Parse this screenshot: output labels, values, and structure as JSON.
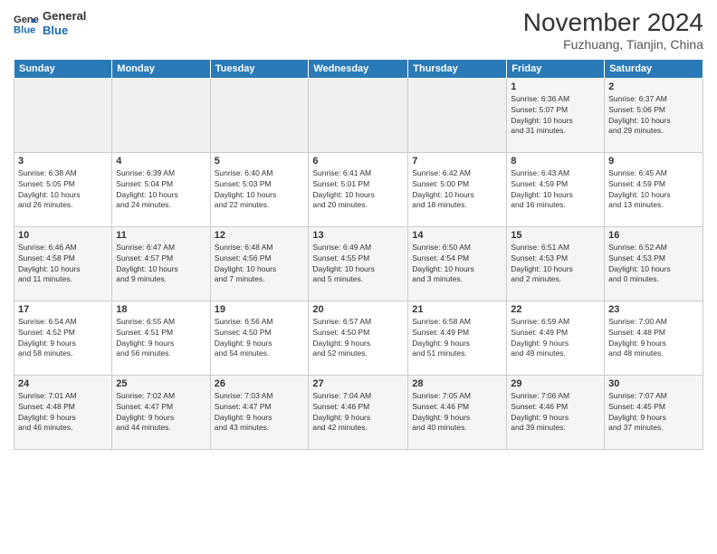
{
  "logo": {
    "line1": "General",
    "line2": "Blue"
  },
  "title": "November 2024",
  "subtitle": "Fuzhuang, Tianjin, China",
  "weekdays": [
    "Sunday",
    "Monday",
    "Tuesday",
    "Wednesday",
    "Thursday",
    "Friday",
    "Saturday"
  ],
  "weeks": [
    [
      {
        "day": "",
        "info": ""
      },
      {
        "day": "",
        "info": ""
      },
      {
        "day": "",
        "info": ""
      },
      {
        "day": "",
        "info": ""
      },
      {
        "day": "",
        "info": ""
      },
      {
        "day": "1",
        "info": "Sunrise: 6:36 AM\nSunset: 5:07 PM\nDaylight: 10 hours\nand 31 minutes."
      },
      {
        "day": "2",
        "info": "Sunrise: 6:37 AM\nSunset: 5:06 PM\nDaylight: 10 hours\nand 29 minutes."
      }
    ],
    [
      {
        "day": "3",
        "info": "Sunrise: 6:38 AM\nSunset: 5:05 PM\nDaylight: 10 hours\nand 26 minutes."
      },
      {
        "day": "4",
        "info": "Sunrise: 6:39 AM\nSunset: 5:04 PM\nDaylight: 10 hours\nand 24 minutes."
      },
      {
        "day": "5",
        "info": "Sunrise: 6:40 AM\nSunset: 5:03 PM\nDaylight: 10 hours\nand 22 minutes."
      },
      {
        "day": "6",
        "info": "Sunrise: 6:41 AM\nSunset: 5:01 PM\nDaylight: 10 hours\nand 20 minutes."
      },
      {
        "day": "7",
        "info": "Sunrise: 6:42 AM\nSunset: 5:00 PM\nDaylight: 10 hours\nand 18 minutes."
      },
      {
        "day": "8",
        "info": "Sunrise: 6:43 AM\nSunset: 4:59 PM\nDaylight: 10 hours\nand 16 minutes."
      },
      {
        "day": "9",
        "info": "Sunrise: 6:45 AM\nSunset: 4:59 PM\nDaylight: 10 hours\nand 13 minutes."
      }
    ],
    [
      {
        "day": "10",
        "info": "Sunrise: 6:46 AM\nSunset: 4:58 PM\nDaylight: 10 hours\nand 11 minutes."
      },
      {
        "day": "11",
        "info": "Sunrise: 6:47 AM\nSunset: 4:57 PM\nDaylight: 10 hours\nand 9 minutes."
      },
      {
        "day": "12",
        "info": "Sunrise: 6:48 AM\nSunset: 4:56 PM\nDaylight: 10 hours\nand 7 minutes."
      },
      {
        "day": "13",
        "info": "Sunrise: 6:49 AM\nSunset: 4:55 PM\nDaylight: 10 hours\nand 5 minutes."
      },
      {
        "day": "14",
        "info": "Sunrise: 6:50 AM\nSunset: 4:54 PM\nDaylight: 10 hours\nand 3 minutes."
      },
      {
        "day": "15",
        "info": "Sunrise: 6:51 AM\nSunset: 4:53 PM\nDaylight: 10 hours\nand 2 minutes."
      },
      {
        "day": "16",
        "info": "Sunrise: 6:52 AM\nSunset: 4:53 PM\nDaylight: 10 hours\nand 0 minutes."
      }
    ],
    [
      {
        "day": "17",
        "info": "Sunrise: 6:54 AM\nSunset: 4:52 PM\nDaylight: 9 hours\nand 58 minutes."
      },
      {
        "day": "18",
        "info": "Sunrise: 6:55 AM\nSunset: 4:51 PM\nDaylight: 9 hours\nand 56 minutes."
      },
      {
        "day": "19",
        "info": "Sunrise: 6:56 AM\nSunset: 4:50 PM\nDaylight: 9 hours\nand 54 minutes."
      },
      {
        "day": "20",
        "info": "Sunrise: 6:57 AM\nSunset: 4:50 PM\nDaylight: 9 hours\nand 52 minutes."
      },
      {
        "day": "21",
        "info": "Sunrise: 6:58 AM\nSunset: 4:49 PM\nDaylight: 9 hours\nand 51 minutes."
      },
      {
        "day": "22",
        "info": "Sunrise: 6:59 AM\nSunset: 4:49 PM\nDaylight: 9 hours\nand 49 minutes."
      },
      {
        "day": "23",
        "info": "Sunrise: 7:00 AM\nSunset: 4:48 PM\nDaylight: 9 hours\nand 48 minutes."
      }
    ],
    [
      {
        "day": "24",
        "info": "Sunrise: 7:01 AM\nSunset: 4:48 PM\nDaylight: 9 hours\nand 46 minutes."
      },
      {
        "day": "25",
        "info": "Sunrise: 7:02 AM\nSunset: 4:47 PM\nDaylight: 9 hours\nand 44 minutes."
      },
      {
        "day": "26",
        "info": "Sunrise: 7:03 AM\nSunset: 4:47 PM\nDaylight: 9 hours\nand 43 minutes."
      },
      {
        "day": "27",
        "info": "Sunrise: 7:04 AM\nSunset: 4:46 PM\nDaylight: 9 hours\nand 42 minutes."
      },
      {
        "day": "28",
        "info": "Sunrise: 7:05 AM\nSunset: 4:46 PM\nDaylight: 9 hours\nand 40 minutes."
      },
      {
        "day": "29",
        "info": "Sunrise: 7:06 AM\nSunset: 4:46 PM\nDaylight: 9 hours\nand 39 minutes."
      },
      {
        "day": "30",
        "info": "Sunrise: 7:07 AM\nSunset: 4:45 PM\nDaylight: 9 hours\nand 37 minutes."
      }
    ]
  ]
}
